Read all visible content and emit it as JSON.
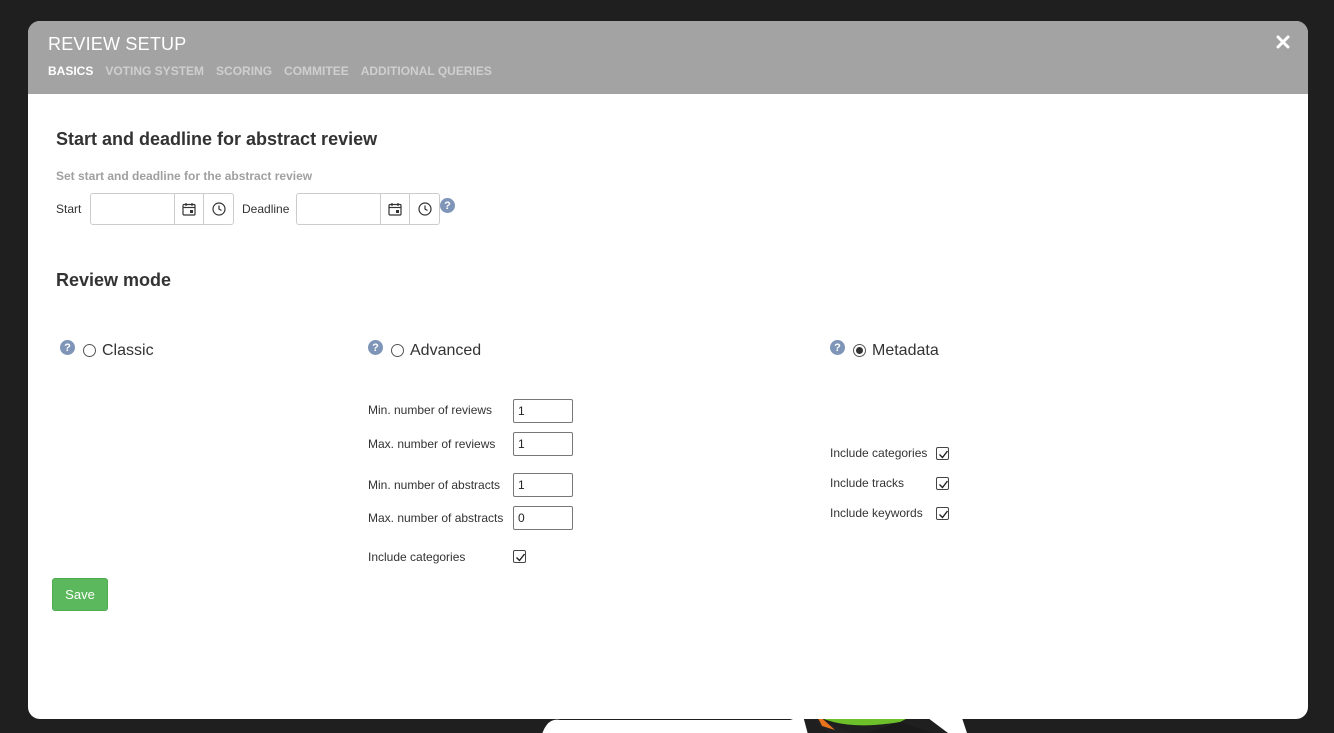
{
  "modal": {
    "title": "REVIEW SETUP",
    "tabs": [
      {
        "label": "BASICS",
        "active": true
      },
      {
        "label": "VOTING SYSTEM",
        "active": false
      },
      {
        "label": "SCORING",
        "active": false
      },
      {
        "label": "COMMITEE",
        "active": false
      },
      {
        "label": "ADDITIONAL QUERIES",
        "active": false
      }
    ]
  },
  "deadline_section": {
    "heading": "Start and deadline for abstract review",
    "hint": "Set start and deadline for the abstract review",
    "start_label": "Start",
    "deadline_label": "Deadline",
    "start_value": "",
    "deadline_value": ""
  },
  "review_mode": {
    "heading": "Review mode",
    "help_glyph": "?",
    "options": [
      {
        "label": "Classic",
        "selected": false
      },
      {
        "label": "Advanced",
        "selected": false
      },
      {
        "label": "Metadata",
        "selected": true
      }
    ],
    "advanced": {
      "min_reviews_label": "Min. number of reviews",
      "min_reviews_value": "1",
      "max_reviews_label": "Max. number of reviews",
      "max_reviews_value": "1",
      "min_abstracts_label": "Min. number of abstracts",
      "min_abstracts_value": "1",
      "max_abstracts_label": "Max. number of abstracts",
      "max_abstracts_value": "0",
      "include_categories_label": "Include categories",
      "include_categories_checked": true
    },
    "metadata": {
      "include_categories_label": "Include categories",
      "include_categories_checked": true,
      "include_tracks_label": "Include tracks",
      "include_tracks_checked": true,
      "include_keywords_label": "Include keywords",
      "include_keywords_checked": true
    }
  },
  "actions": {
    "save_label": "Save"
  },
  "colors": {
    "header_bg": "#a3a3a3",
    "save_green": "#5cb85c",
    "help_blue": "#7f95b8"
  }
}
